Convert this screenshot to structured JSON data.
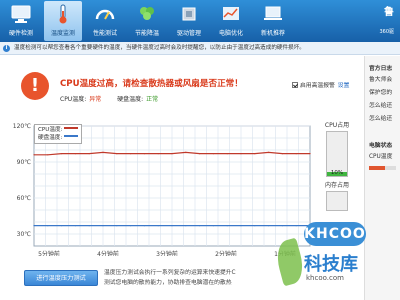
{
  "toolbar": {
    "tabs": [
      {
        "label": "硬件检测",
        "icon": "monitor-icon"
      },
      {
        "label": "温度监测",
        "icon": "thermometer-icon"
      },
      {
        "label": "性能测试",
        "icon": "gauge-icon"
      },
      {
        "label": "节能降温",
        "icon": "leaf-icon"
      },
      {
        "label": "驱动管理",
        "icon": "chip-icon"
      },
      {
        "label": "电脑优化",
        "icon": "chart-icon"
      },
      {
        "label": "新机推荐",
        "icon": "laptop-icon"
      }
    ],
    "active_tab": 1,
    "brand": "鲁",
    "brand_sub": "360驱"
  },
  "info_bar": {
    "text": "温度检测可以帮您查看各个重要硬件的温度，当硬件温度过高时会及时提醒您，以防止由于温度过高造成的硬件损坏。"
  },
  "status": {
    "alert": "CPU温度过高，请检查散热器或风扇是否正常！",
    "cpu_label": "CPU温度:",
    "cpu_value": "异常",
    "disk_label": "硬盘温度:",
    "disk_value": "正常",
    "alarm_label": "启用高温报警",
    "alarm_checked": true,
    "settings_link": "设置"
  },
  "chart_data": {
    "type": "line",
    "y_ticks": [
      "120℃",
      "90℃",
      "60℃",
      "30℃"
    ],
    "ylim": [
      20,
      120
    ],
    "x_ticks": [
      "5分钟前",
      "4分钟前",
      "3分钟前",
      "2分钟前",
      "1分钟前"
    ],
    "series": [
      {
        "name": "CPU温度:",
        "color": "#c0392b",
        "values": [
          96,
          96,
          97,
          97,
          97,
          98,
          97,
          97,
          97,
          97,
          97,
          98,
          97,
          97,
          97,
          97,
          97,
          98,
          97,
          97,
          97
        ]
      },
      {
        "name": "硬盘温度:",
        "color": "#3a78c9",
        "values": [
          37,
          37,
          37,
          37,
          37,
          37,
          37,
          37,
          37,
          37,
          37,
          37,
          37,
          37,
          37,
          37,
          37,
          37,
          37,
          37,
          37
        ]
      }
    ],
    "grid": true
  },
  "usage": {
    "cpu_title": "CPU占用",
    "cpu_percent": 10,
    "cpu_text": "10%",
    "mem_title": "内存占用"
  },
  "test": {
    "button": "进行温度压力测试",
    "desc_line1": "温度压力测试会执行一系列复杂的运算来快速提升C",
    "desc_line2": "测试您电脑的散热能力，协助排查电脑潜在的散热"
  },
  "sidebar": {
    "title": "官方日志",
    "items": [
      "鲁大师会",
      "保护您的",
      "怎么给还",
      "怎么给还"
    ],
    "pc_status_title": "电脑状态",
    "cpu_temp_label": "CPU温度"
  },
  "watermark": {
    "logo": "KHCOO",
    "text": "科技库",
    "url": "khcoo.com"
  }
}
